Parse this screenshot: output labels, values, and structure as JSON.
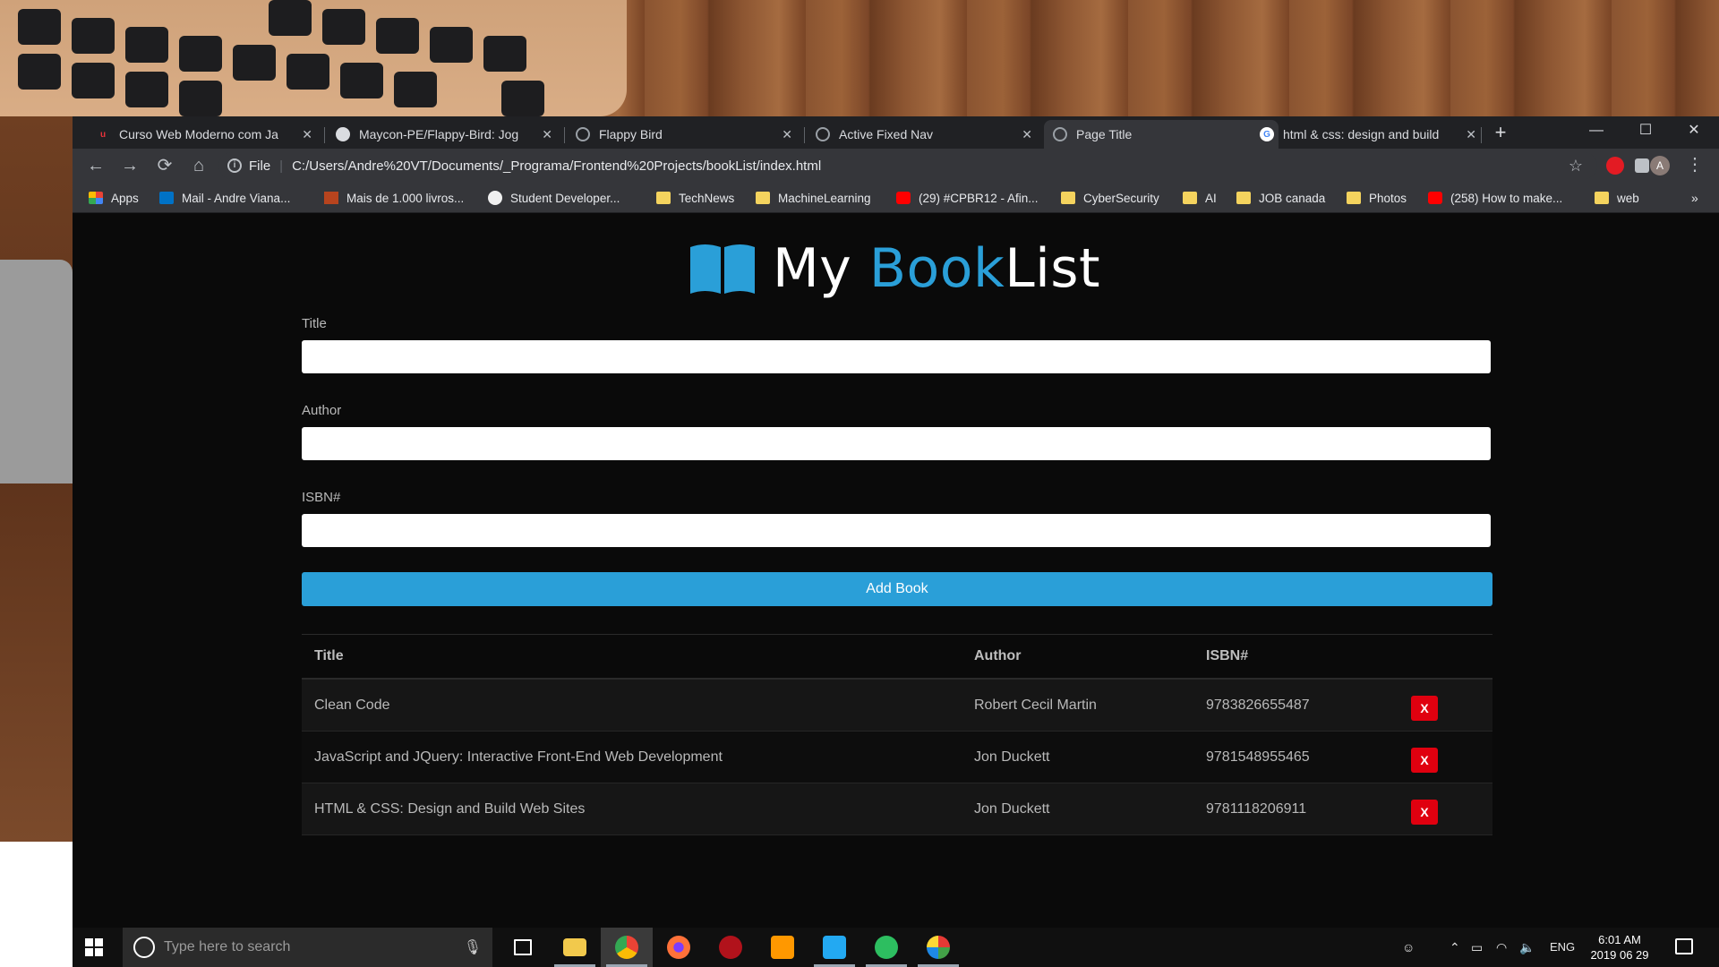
{
  "browser": {
    "tabs": [
      {
        "label": "Curso Web Moderno com Ja",
        "icon": "udemy-icon",
        "active": false
      },
      {
        "label": "Maycon-PE/Flappy-Bird: Jog",
        "icon": "github-icon",
        "active": false
      },
      {
        "label": "Flappy Bird",
        "icon": "globe-icon",
        "active": false
      },
      {
        "label": "Active Fixed Nav",
        "icon": "globe-icon",
        "active": false
      },
      {
        "label": "Page Title",
        "icon": "globe-icon",
        "active": true
      },
      {
        "label": "html & css: design and build",
        "icon": "google-icon",
        "active": false
      }
    ],
    "address": {
      "scheme": "File",
      "url": "C:/Users/Andre%20VT/Documents/_Programa/Frontend%20Projects/bookList/index.html"
    },
    "profile_initial": "A",
    "bookmarks": [
      {
        "label": "Apps",
        "icon": "apps-grid-icon"
      },
      {
        "label": "Mail - Andre Viana...",
        "icon": "outlook-icon"
      },
      {
        "label": "Mais de 1.000 livros...",
        "icon": "book-icon"
      },
      {
        "label": "Student Developer...",
        "icon": "github-icon"
      },
      {
        "label": "TechNews",
        "icon": "folder-icon"
      },
      {
        "label": "MachineLearning",
        "icon": "folder-icon"
      },
      {
        "label": "(29) #CPBR12 - Afin...",
        "icon": "youtube-icon"
      },
      {
        "label": "CyberSecurity",
        "icon": "folder-icon"
      },
      {
        "label": "AI",
        "icon": "folder-icon"
      },
      {
        "label": "JOB canada",
        "icon": "folder-icon"
      },
      {
        "label": "Photos",
        "icon": "folder-icon"
      },
      {
        "label": "(258) How to make...",
        "icon": "youtube-icon"
      },
      {
        "label": "web",
        "icon": "folder-icon"
      }
    ],
    "bookmarks_more": "»"
  },
  "page": {
    "brand": {
      "part1": "My ",
      "accent": "Book",
      "part2": "List"
    },
    "form": {
      "title_label": "Title",
      "author_label": "Author",
      "isbn_label": "ISBN#",
      "submit_label": "Add Book"
    },
    "table": {
      "headers": {
        "title": "Title",
        "author": "Author",
        "isbn": "ISBN#"
      },
      "rows": [
        {
          "title": "Clean Code",
          "author": "Robert Cecil Martin",
          "isbn": "9783826655487",
          "delete": "X"
        },
        {
          "title": "JavaScript and JQuery: Interactive Front-End Web Development",
          "author": "Jon Duckett",
          "isbn": "9781548955465",
          "delete": "X"
        },
        {
          "title": "HTML & CSS: Design and Build Web Sites",
          "author": "Jon Duckett",
          "isbn": "9781118206911",
          "delete": "X"
        }
      ]
    }
  },
  "taskbar": {
    "search_placeholder": "Type here to search",
    "language": "ENG",
    "time": "6:01 AM",
    "date": "2019 06 29"
  },
  "colors": {
    "accent": "#2a9fd8",
    "delete": "#e0000f",
    "background": "#0a0a0a"
  }
}
